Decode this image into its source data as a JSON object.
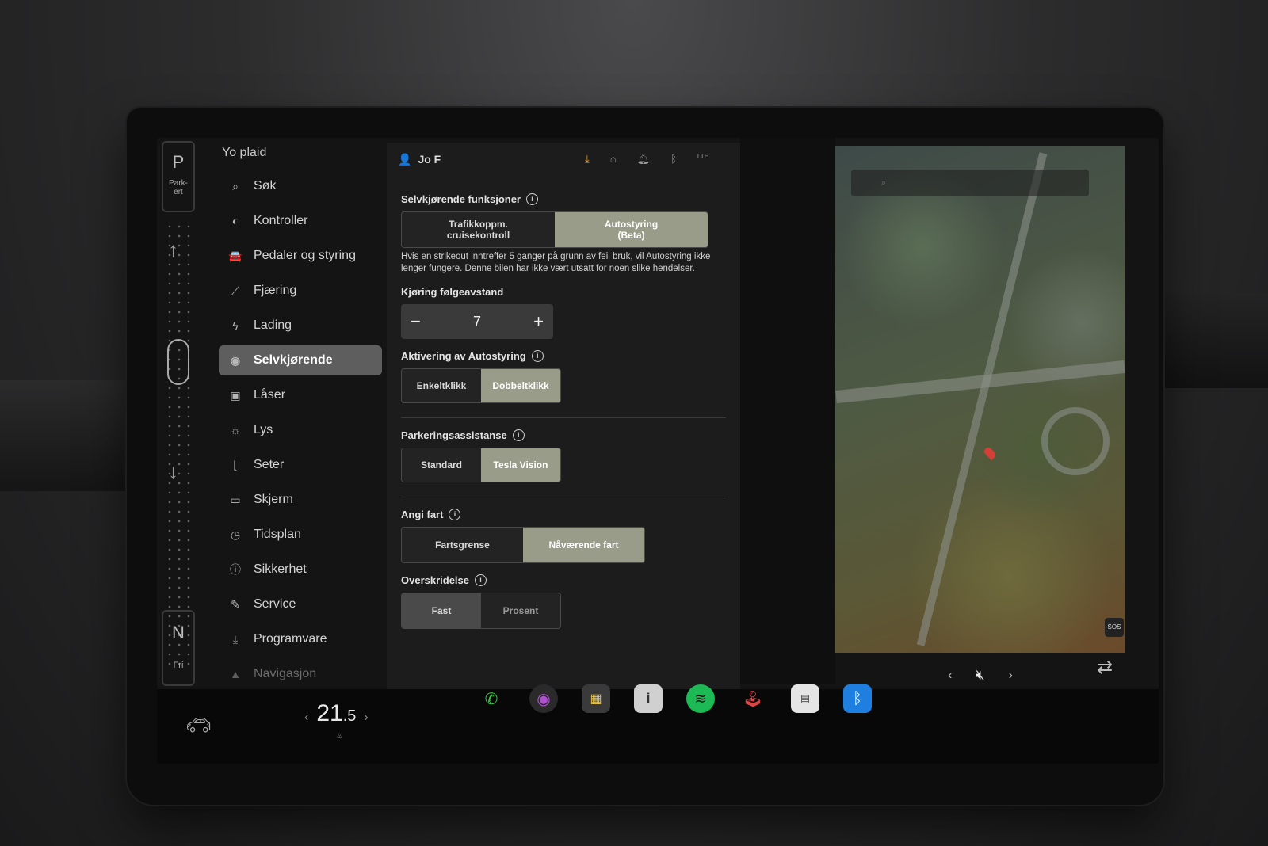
{
  "gear": {
    "park": "P",
    "park_label": "Park-\nert",
    "neutral": "N",
    "neutral_label": "Fri"
  },
  "sidebar": {
    "title": "Yo plaid",
    "items": [
      {
        "label": "Søk",
        "icon": "search-icon"
      },
      {
        "label": "Kontroller",
        "icon": "toggle-icon"
      },
      {
        "label": "Pedaler og styring",
        "icon": "car-icon"
      },
      {
        "label": "Fjæring",
        "icon": "suspension-icon"
      },
      {
        "label": "Lading",
        "icon": "bolt-icon"
      },
      {
        "label": "Selvkjørende",
        "icon": "steering-wheel-icon",
        "active": true
      },
      {
        "label": "Låser",
        "icon": "lock-icon"
      },
      {
        "label": "Lys",
        "icon": "sun-icon"
      },
      {
        "label": "Seter",
        "icon": "seat-icon"
      },
      {
        "label": "Skjerm",
        "icon": "display-icon"
      },
      {
        "label": "Tidsplan",
        "icon": "clock-icon"
      },
      {
        "label": "Sikkerhet",
        "icon": "shield-icon"
      },
      {
        "label": "Service",
        "icon": "wrench-icon"
      },
      {
        "label": "Programvare",
        "icon": "download-icon"
      },
      {
        "label": "Navigasjon",
        "icon": "navigation-icon"
      }
    ]
  },
  "topbar": {
    "user": "Jo F",
    "status_icons": [
      "download-icon",
      "homelink-icon",
      "bell-icon",
      "bluetooth-icon",
      "lte-signal-icon"
    ],
    "lte": "LTE"
  },
  "autopilot": {
    "self_driving_label": "Selvkjørende funksjoner",
    "self_driving_options": [
      "Trafikkoppm.\ncruisekontroll",
      "Autostyring\n(Beta)"
    ],
    "self_driving_selected": 1,
    "strikeout_text": "Hvis en strikeout inntreffer 5 ganger på grunn av feil bruk, vil Autostyring ikke lenger fungere. Denne bilen har ikke vært utsatt for noen slike hendelser.",
    "following_label": "Kjøring følgeavstand",
    "following_value": "7",
    "activation_label": "Aktivering av Autostyring",
    "activation_options": [
      "Enkeltklikk",
      "Dobbeltklikk"
    ],
    "activation_selected": 1,
    "parking_label": "Parkeringsassistanse",
    "parking_options": [
      "Standard",
      "Tesla Vision"
    ],
    "parking_selected": 1,
    "speed_label": "Angi fart",
    "speed_options": [
      "Fartsgrense",
      "Nåværende fart"
    ],
    "speed_selected": 1,
    "offset_label": "Overskridelse",
    "offset_options": [
      "Fast",
      "Prosent"
    ],
    "offset_selected": 0
  },
  "bottombar": {
    "temperature": "21",
    "temperature_decimal": ".5",
    "sos": "SOS",
    "apps": [
      "phone-icon",
      "camera-icon",
      "toybox-icon",
      "manual-icon",
      "spotify-icon",
      "arcade-icon",
      "calendar-icon",
      "bluetooth-icon"
    ]
  },
  "colors": {
    "accent_selected": "#9a9c8a",
    "download_status": "#f2a62b",
    "phone": "#3cc448",
    "spotify": "#1db954",
    "bluetooth": "#1e7fe0"
  }
}
